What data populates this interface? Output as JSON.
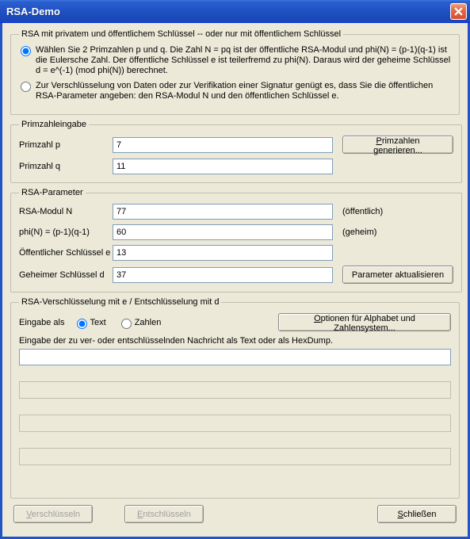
{
  "window": {
    "title": "RSA-Demo"
  },
  "mode": {
    "legend": "RSA mit privatem und öffentlichem Schlüssel -- oder nur mit öffentlichem Schlüssel",
    "opt1": "Wählen Sie 2 Primzahlen p und q. Die Zahl N = pq ist der öffentliche RSA-Modul und phi(N) = (p-1)(q-1) ist die Eulersche Zahl. Der öffentliche Schlüssel e ist teilerfremd zu phi(N). Daraus wird der geheime Schlüssel d = e^(-1) (mod  phi(N)) berechnet.",
    "opt2": "Zur Verschlüsselung von Daten oder zur Verifikation einer Signatur genügt es, dass Sie die öffentlichen RSA-Parameter angeben: den RSA-Modul N und den öffentlichen Schlüssel e."
  },
  "primes": {
    "legend": "Primzahleingabe",
    "p_label": "Primzahl p",
    "p_value": "7",
    "q_label": "Primzahl q",
    "q_value": "11",
    "generate": "Primzahlen generieren..."
  },
  "params": {
    "legend": "RSA-Parameter",
    "n_label": "RSA-Modul N",
    "n_value": "77",
    "n_note": "(öffentlich)",
    "phi_label": "phi(N) = (p-1)(q-1)",
    "phi_value": "60",
    "phi_note": "(geheim)",
    "e_label": "Öffentlicher Schlüssel e",
    "e_value": "13",
    "d_label": "Geheimer Schlüssel d",
    "d_value": "37",
    "update": "Parameter aktualisieren"
  },
  "crypt": {
    "legend": "RSA-Verschlüsselung mit e / Entschlüsselung mit d",
    "input_as": "Eingabe als",
    "mode_text": "Text",
    "mode_numbers": "Zahlen",
    "options": "Optionen für Alphabet und Zahlensystem...",
    "msg_label": "Eingabe der zu ver- oder entschlüsselnden Nachricht als Text oder als HexDump.",
    "msg_value": ""
  },
  "buttons": {
    "encrypt": "Verschlüsseln",
    "decrypt": "Entschlüsseln",
    "close": "Schließen"
  }
}
